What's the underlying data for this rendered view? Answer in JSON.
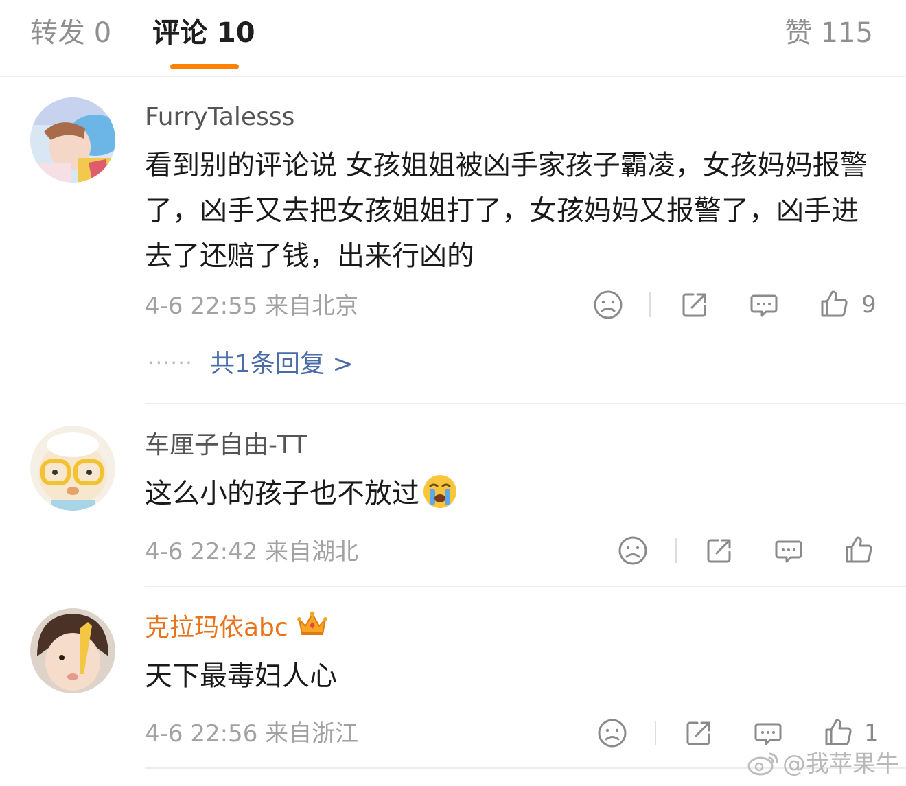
{
  "tabs": {
    "repost": "转发 0",
    "comments": "评论 10",
    "likes": "赞 115"
  },
  "comments": [
    {
      "username": "FurryTalesss",
      "text": "看到别的评论说 女孩姐姐被凶手家孩子霸凌，女孩妈妈报警了，凶手又去把女孩姐姐打了，女孩妈妈又报警了，凶手进去了还赔了钱，出来行凶的",
      "meta": "4-6 22:55 来自北京",
      "like_count": "9",
      "reply_summary": "共1条回复 >",
      "reply_dots": "······"
    },
    {
      "username": "车厘子自由-TT",
      "text": "这么小的孩子也不放过",
      "emoji": "crying-emoji",
      "meta": "4-6 22:42 来自湖北",
      "like_count": ""
    },
    {
      "username": "克拉玛依abc",
      "badge": "crown-icon",
      "text": "天下最毒妇人心",
      "meta": "4-6 22:56 来自浙江",
      "like_count": "1"
    }
  ],
  "watermark": "@我苹果牛",
  "colors": {
    "tab_underline": "#ff8200",
    "reply_link": "#4a6ca8",
    "vip_username": "#e8731a"
  }
}
